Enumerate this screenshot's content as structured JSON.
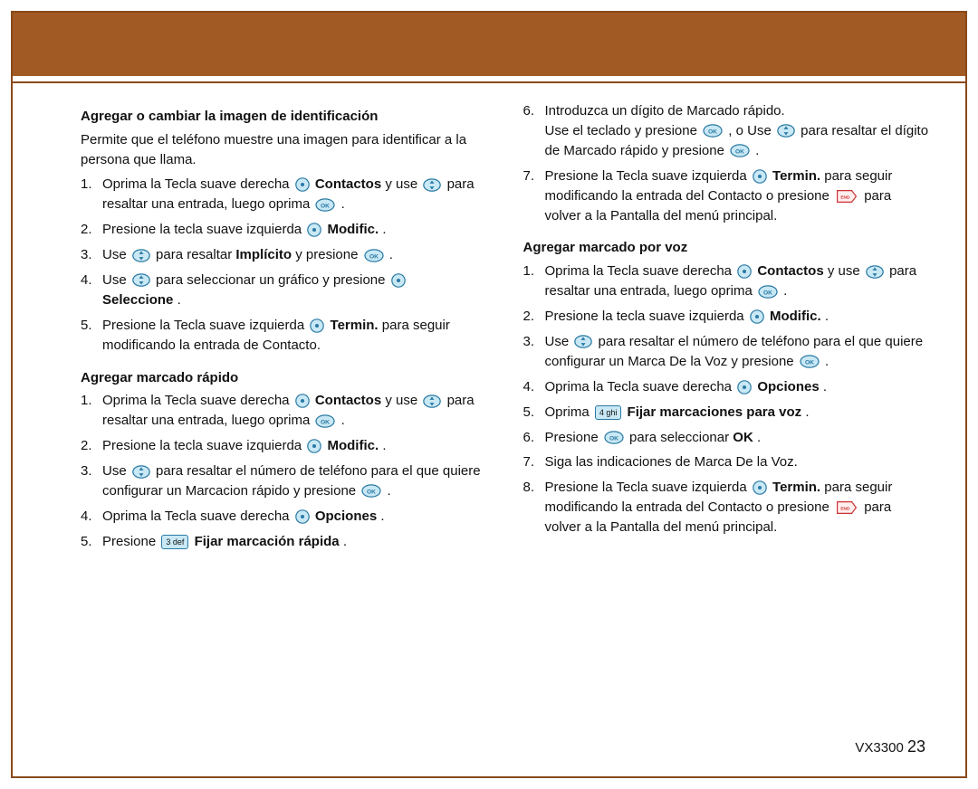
{
  "footer": {
    "model": "VX3300",
    "page": "23"
  },
  "section1": {
    "title": "Agregar o cambiar la imagen de identificación",
    "intro": "Permite que el teléfono muestre una imagen para identificar a la persona  que llama.",
    "s1_1a": "Oprima la Tecla suave derecha ",
    "s1_1b": " Contactos",
    "s1_1c": " y use ",
    "s1_1d": " para resaltar una entrada, luego oprima ",
    "s1_1e": " .",
    "s1_2a": "Presione la tecla suave izquierda ",
    "s1_2b": " Modific.",
    "s1_2c": ".",
    "s1_3a": "Use ",
    "s1_3b": " para resaltar ",
    "s1_3c": "Implícito",
    "s1_3d": " y presione ",
    "s1_3e": " .",
    "s1_4a": "Use ",
    "s1_4b": " para seleccionar un gráfico y presione ",
    "s1_4c": "Seleccione",
    "s1_4d": ".",
    "s1_5a": "Presione la Tecla suave izquierda ",
    "s1_5b": " Termin.",
    "s1_5c": " para seguir modificando la entrada de Contacto."
  },
  "section2": {
    "title": "Agregar marcado rápido",
    "s2_1a": "Oprima la Tecla suave derecha ",
    "s2_1b": " Contactos",
    "s2_1c": " y use ",
    "s2_1d": " para resaltar una entrada, luego oprima ",
    "s2_1e": " .",
    "s2_2a": "Presione la tecla suave izquierda ",
    "s2_2b": " Modific.",
    "s2_2c": ".",
    "s2_3a": "Use ",
    "s2_3b": " para resaltar el número de teléfono para el que quiere configurar un Marcacion rápido y presione ",
    "s2_3c": " .",
    "s2_4a": "Oprima la Tecla suave derecha ",
    "s2_4b": " Opciones",
    "s2_4c": ".",
    "s2_5a": "Presione ",
    "s2_5b": " Fijar marcación rápida",
    "s2_5c": ".",
    "s2_6a": "Introduzca un dígito de Marcado rápido.",
    "s2_6b": "Use el teclado y presione ",
    "s2_6c": " ,  o Use ",
    "s2_6d": " para resaltar el dígito de Marcado rápido y presione ",
    "s2_6e": " .",
    "s2_7a": "Presione la Tecla suave izquierda ",
    "s2_7b": " Termin.",
    "s2_7c": " para seguir modificando la entrada del Contacto o presione ",
    "s2_7d": " para volver a la Pantalla del menú principal."
  },
  "section3": {
    "title": "Agregar marcado por voz",
    "s3_1a": "Oprima la Tecla suave derecha ",
    "s3_1b": " Contactos",
    "s3_1c": " y use ",
    "s3_1d": " para resaltar una entrada, luego oprima ",
    "s3_1e": " .",
    "s3_2a": "Presione la tecla suave izquierda ",
    "s3_2b": " Modific.",
    "s3_2c": ".",
    "s3_3a": "Use ",
    "s3_3b": " para resaltar el número de teléfono para el que quiere configurar un Marca De la Voz y presione ",
    "s3_3c": " .",
    "s3_4a": "Oprima la Tecla suave derecha ",
    "s3_4b": " Opciones",
    "s3_4c": ".",
    "s3_5a": "Oprima ",
    "s3_5b": " Fijar marcaciones para voz",
    "s3_5c": ".",
    "s3_6a": "Presione ",
    "s3_6b": " para seleccionar ",
    "s3_6c": "OK",
    "s3_6d": ".",
    "s3_7a": "Siga las indicaciones de Marca De la Voz.",
    "s3_8a": "Presione la Tecla suave izquierda ",
    "s3_8b": " Termin.",
    "s3_8c": " para seguir modificando la entrada del Contacto o presione ",
    "s3_8d": " para volver a la Pantalla del menú principal."
  },
  "keys": {
    "k3": "3 def",
    "k4": "4 ghi"
  }
}
